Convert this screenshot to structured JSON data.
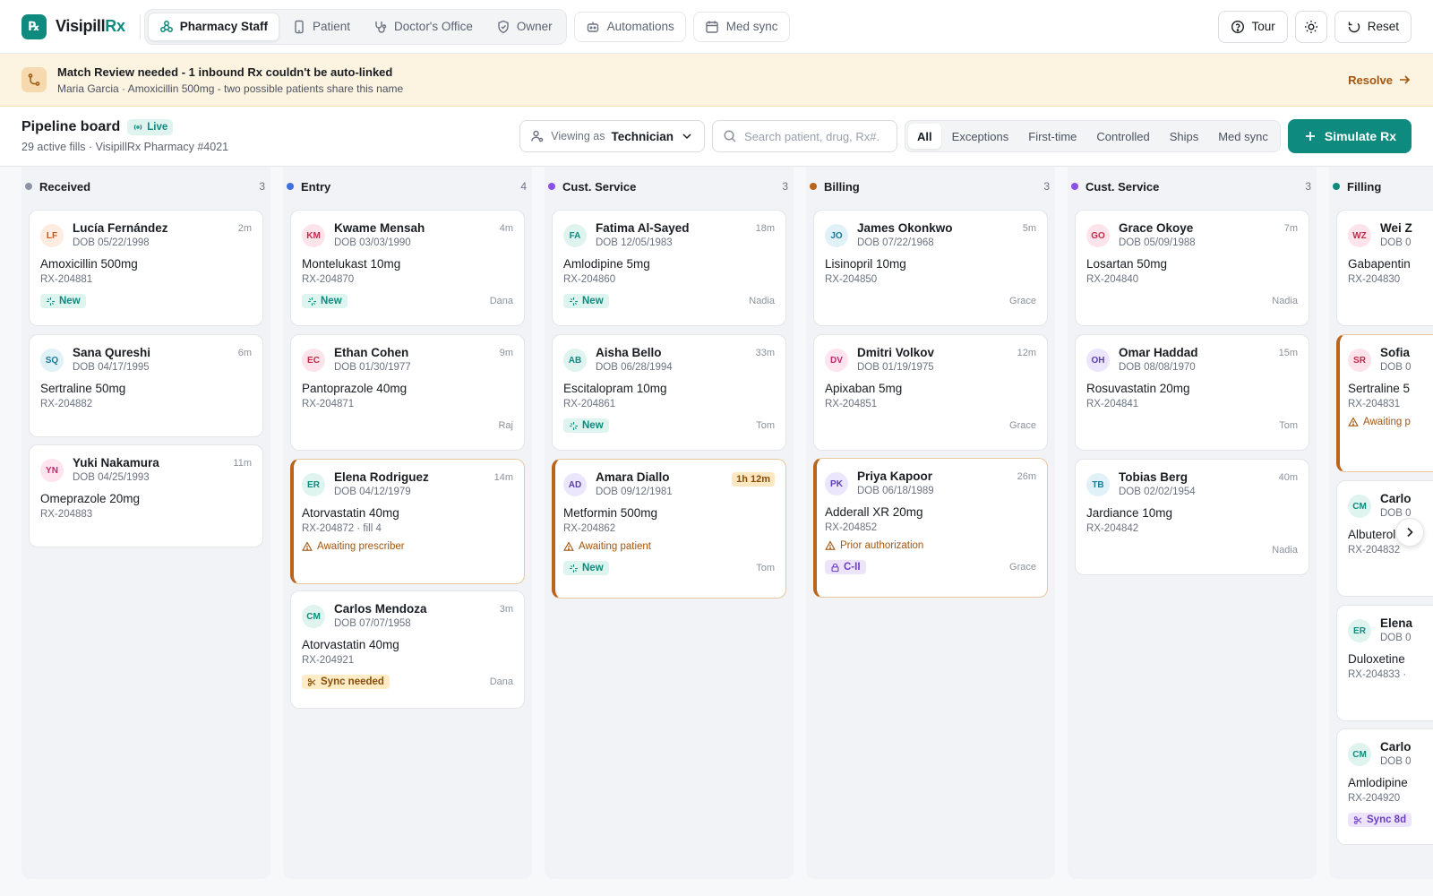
{
  "app": {
    "logo_mark": "℞",
    "name_a": "Visipill",
    "name_b": "Rx"
  },
  "roles": [
    {
      "label": "Pharmacy Staff",
      "icon": "tree-nodes-icon",
      "active": true
    },
    {
      "label": "Patient",
      "icon": "phone-icon",
      "active": false
    },
    {
      "label": "Doctor's Office",
      "icon": "stethoscope-icon",
      "active": false
    },
    {
      "label": "Owner",
      "icon": "shield-icon",
      "active": false
    }
  ],
  "nav": {
    "automations": "Automations",
    "med_sync": "Med sync"
  },
  "tools": {
    "tour": "Tour",
    "reset": "Reset"
  },
  "banner": {
    "title": "Match Review needed - 1 inbound Rx couldn't be auto-linked",
    "subtitle": "Maria Garcia · Amoxicillin 500mg - two possible patients share this name",
    "action": "Resolve"
  },
  "board": {
    "title": "Pipeline board",
    "live": "Live",
    "subtitle": "29 active fills · VisipillRx Pharmacy #4021",
    "viewing_label": "Viewing as",
    "viewing_value": "Technician",
    "search_placeholder": "Search patient, drug, Rx#...",
    "filters": [
      "All",
      "Exceptions",
      "First-time",
      "Controlled",
      "Ships",
      "Med sync"
    ],
    "simulate": "Simulate Rx"
  },
  "colors": {
    "accent": "#0f8a7e",
    "warning": "#b8641a",
    "received": "#8b95a5",
    "entry": "#3f6fe0",
    "cust_service": "#8b4fe6",
    "billing": "#b8641a",
    "filling": "#0f8a7e"
  },
  "columns": [
    {
      "title": "Received",
      "count": "3",
      "cards": [
        {
          "initials": "LF",
          "name": "Lucía Fernández",
          "dob": "DOB 05/22/1998",
          "age": "2m",
          "drug": "Amoxicillin 500mg",
          "rx": "RX-204881",
          "tag": "New",
          "assignee": ""
        },
        {
          "initials": "SQ",
          "name": "Sana Qureshi",
          "dob": "DOB 04/17/1995",
          "age": "6m",
          "drug": "Sertraline 50mg",
          "rx": "RX-204882",
          "tag": "",
          "assignee": ""
        },
        {
          "initials": "YN",
          "name": "Yuki Nakamura",
          "dob": "DOB 04/25/1993",
          "age": "11m",
          "drug": "Omeprazole 20mg",
          "rx": "RX-204883",
          "tag": "",
          "assignee": ""
        }
      ]
    },
    {
      "title": "Entry",
      "count": "4",
      "cards": [
        {
          "initials": "KM",
          "name": "Kwame Mensah",
          "dob": "DOB 03/03/1990",
          "age": "4m",
          "drug": "Montelukast 10mg",
          "rx": "RX-204870",
          "tag": "New",
          "assignee": "Dana"
        },
        {
          "initials": "EC",
          "name": "Ethan Cohen",
          "dob": "DOB 01/30/1977",
          "age": "9m",
          "drug": "Pantoprazole 40mg",
          "rx": "RX-204871",
          "tag": "",
          "assignee": "Raj"
        },
        {
          "initials": "ER",
          "name": "Elena Rodriguez",
          "dob": "DOB 04/12/1979",
          "age": "14m",
          "drug": "Atorvastatin 40mg",
          "rx": "RX-204872 · fill 4",
          "alert": "Awaiting prescriber",
          "tag": "",
          "assignee": ""
        },
        {
          "initials": "CM",
          "name": "Carlos Mendoza",
          "dob": "DOB 07/07/1958",
          "age": "3m",
          "drug": "Atorvastatin 40mg",
          "rx": "RX-204921",
          "tag": "Sync needed",
          "assignee": "Dana"
        }
      ]
    },
    {
      "title": "Cust. Service",
      "count": "3",
      "cards": [
        {
          "initials": "FA",
          "name": "Fatima Al-Sayed",
          "dob": "DOB 12/05/1983",
          "age": "18m",
          "drug": "Amlodipine 5mg",
          "rx": "RX-204860",
          "tag": "New",
          "assignee": "Nadia"
        },
        {
          "initials": "AB",
          "name": "Aisha Bello",
          "dob": "DOB 06/28/1994",
          "age": "33m",
          "drug": "Escitalopram 10mg",
          "rx": "RX-204861",
          "tag": "New",
          "assignee": "Tom"
        },
        {
          "initials": "AD",
          "name": "Amara Diallo",
          "dob": "DOB 09/12/1981",
          "age": "1h 12m",
          "drug": "Metformin 500mg",
          "rx": "RX-204862",
          "alert": "Awaiting patient",
          "tag": "New",
          "assignee": "Tom"
        }
      ]
    },
    {
      "title": "Billing",
      "count": "3",
      "cards": [
        {
          "initials": "JO",
          "name": "James Okonkwo",
          "dob": "DOB 07/22/1968",
          "age": "5m",
          "drug": "Lisinopril 10mg",
          "rx": "RX-204850",
          "tag": "",
          "assignee": "Grace"
        },
        {
          "initials": "DV",
          "name": "Dmitri Volkov",
          "dob": "DOB 01/19/1975",
          "age": "12m",
          "drug": "Apixaban 5mg",
          "rx": "RX-204851",
          "tag": "",
          "assignee": "Grace"
        },
        {
          "initials": "PK",
          "name": "Priya Kapoor",
          "dob": "DOB 06/18/1989",
          "age": "26m",
          "drug": "Adderall XR 20mg",
          "rx": "RX-204852",
          "alert": "Prior authorization",
          "tag": "C-II",
          "assignee": "Grace"
        }
      ]
    },
    {
      "title": "Cust. Service",
      "count": "3",
      "cards": [
        {
          "initials": "GO",
          "name": "Grace Okoye",
          "dob": "DOB 05/09/1988",
          "age": "7m",
          "drug": "Losartan 50mg",
          "rx": "RX-204840",
          "tag": "",
          "assignee": "Nadia"
        },
        {
          "initials": "OH",
          "name": "Omar Haddad",
          "dob": "DOB 08/08/1970",
          "age": "15m",
          "drug": "Rosuvastatin 20mg",
          "rx": "RX-204841",
          "tag": "",
          "assignee": "Tom"
        },
        {
          "initials": "TB",
          "name": "Tobias Berg",
          "dob": "DOB 02/02/1954",
          "age": "40m",
          "drug": "Jardiance 10mg",
          "rx": "RX-204842",
          "tag": "",
          "assignee": "Nadia"
        }
      ]
    },
    {
      "title": "Filling",
      "count": "",
      "cards": [
        {
          "initials": "WZ",
          "name": "Wei Z",
          "dob": "DOB 0",
          "age": "",
          "drug": "Gabapentin",
          "rx": "RX-204830",
          "tag": "",
          "assignee": ""
        },
        {
          "initials": "SR",
          "name": "Sofia",
          "dob": "DOB 0",
          "age": "",
          "drug": "Sertraline 5",
          "rx": "RX-204831",
          "alert": "Awaiting p",
          "tag": "",
          "assignee": ""
        },
        {
          "initials": "CM",
          "name": "Carlo",
          "dob": "DOB 0",
          "age": "",
          "drug": "Albuterol H",
          "rx": "RX-204832",
          "tag": "",
          "assignee": ""
        },
        {
          "initials": "ER",
          "name": "Elena",
          "dob": "DOB 0",
          "age": "",
          "drug": "Duloxetine",
          "rx": "RX-204833 ·",
          "tag": "",
          "assignee": ""
        },
        {
          "initials": "CM",
          "name": "Carlo",
          "dob": "DOB 0",
          "age": "",
          "drug": "Amlodipine",
          "rx": "RX-204920",
          "tag": "Sync 8d",
          "assignee": ""
        }
      ]
    }
  ]
}
